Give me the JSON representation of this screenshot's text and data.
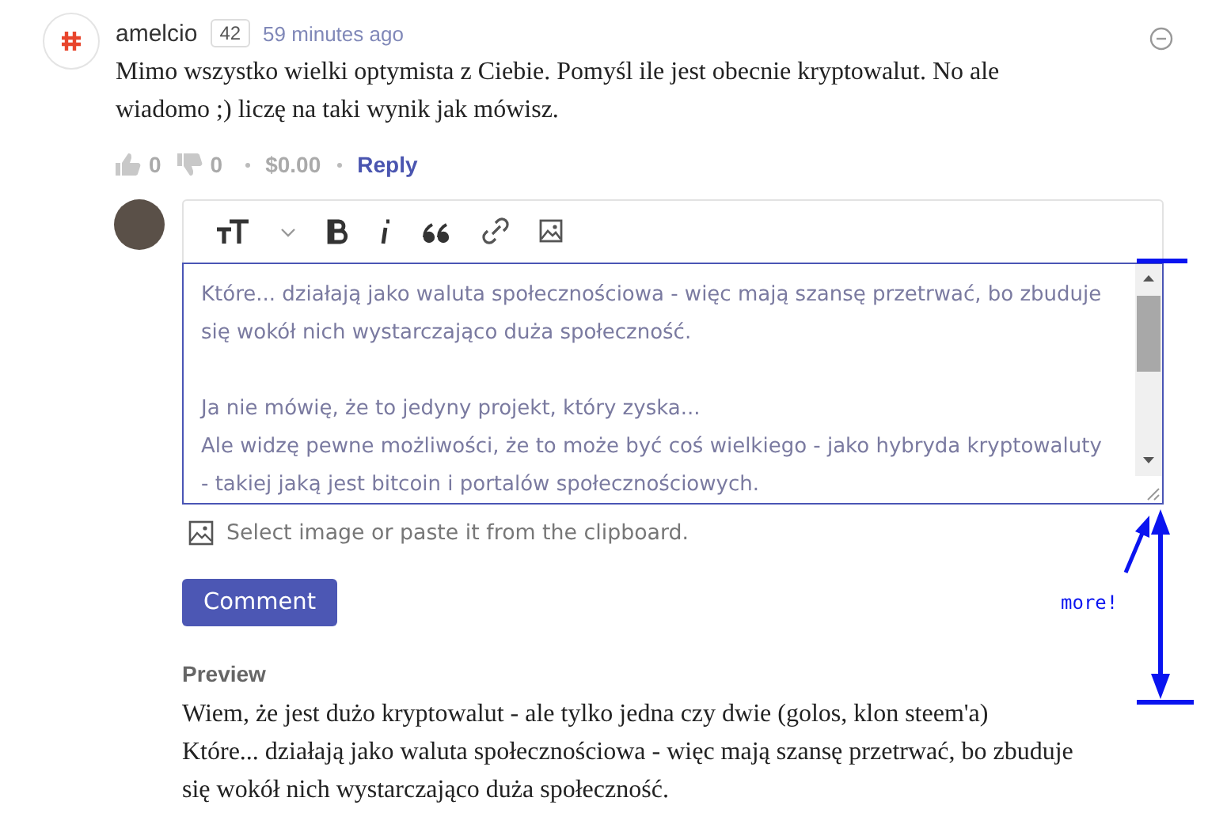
{
  "comment": {
    "author": "amelcio",
    "reputation": "42",
    "time": "59 minutes ago",
    "body": "Mimo wszystko wielki optymista z Ciebie. Pomyśl ile jest obecnie kryptowalut. No ale wiadomo ;) liczę na taki wynik jak mówisz.",
    "upvotes": "0",
    "downvotes": "0",
    "payout": "$0.00",
    "reply": "Reply"
  },
  "editor": {
    "paragraphs": [
      [
        "Które... działają jako waluta społecznościowa - więc mają szansę przetrwać, bo zbuduje",
        "się wokół nich wystarczająco duża społeczność."
      ],
      [
        "Ja nie mówię, że to jedyny projekt, który zyska...",
        "Ale widzę pewne możliwości, że to może być coś wielkiego - jako hybryda kryptowaluty",
        "- takiej jaką jest bitcoin i portalów społecznościowych."
      ]
    ],
    "image_hint": "Select image or paste it from the clipboard.",
    "submit": "Comment"
  },
  "preview": {
    "label": "Preview",
    "lines": [
      "Wiem, że jest dużo kryptowalut - ale tylko jedna czy dwie (golos, klon steem'a)",
      "Które... działają jako waluta społecznościowa - więc mają szansę przetrwać, bo zbuduje",
      "się wokół nich wystarczająco duża społeczność."
    ]
  },
  "annotation": {
    "note": "more!"
  }
}
